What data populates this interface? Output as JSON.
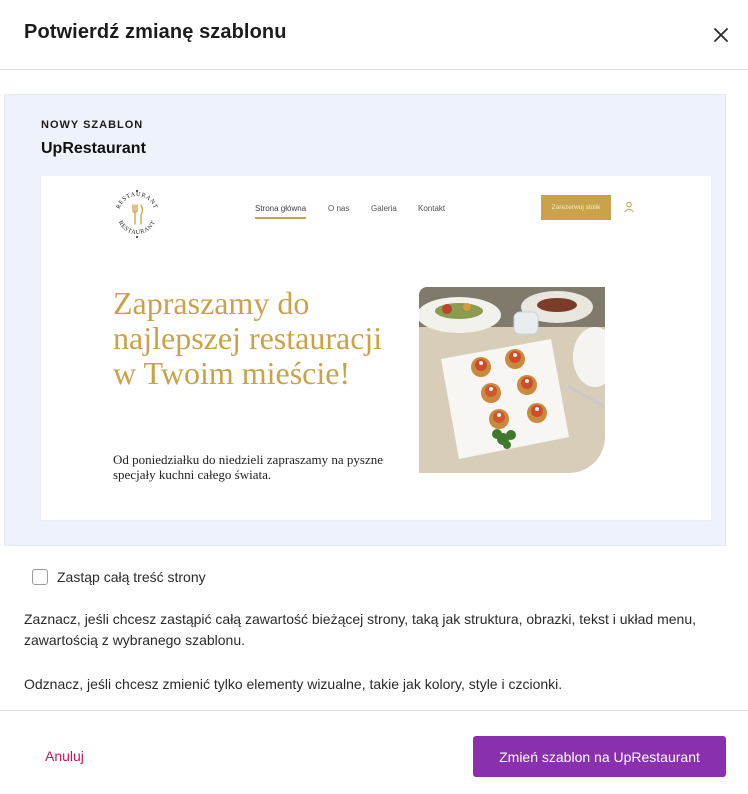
{
  "dialog": {
    "title": "Potwierdź zmianę szablonu"
  },
  "preview": {
    "eyebrow": "NOWY SZABLON",
    "template_name": "UpRestaurant",
    "site": {
      "logo_text_top": "RESTAURANT",
      "logo_text_bottom": "RESTAURANT",
      "nav": [
        "Strona główna",
        "O nas",
        "Galeria",
        "Kontakt"
      ],
      "cta": "Zarezerwuj stolik",
      "hero_title": "Zapraszamy do najlepszej restauracji w Twoim mieście!",
      "hero_subtitle": "Od poniedziałku do niedzieli zapraszamy na pyszne specjały kuchni całego świata."
    }
  },
  "option": {
    "label": "Zastąp całą treść strony",
    "checked": false
  },
  "help": {
    "checked_text": "Zaznacz, jeśli chcesz zastąpić całą zawartość bieżącej strony, taką jak struktura, obrazki, tekst i układ menu, zawartością z wybranego szablonu.",
    "unchecked_text": "Odznacz, jeśli chcesz zmienić tylko elementy wizualne, takie jak kolory, style i czcionki."
  },
  "footer": {
    "cancel_label": "Anuluj",
    "confirm_label": "Zmień szablon na UpRestaurant"
  },
  "colors": {
    "accent_purple": "#8a2fae",
    "cancel_pink": "#c2185b",
    "template_gold": "#c9a24a",
    "preview_bg": "#eef3fb"
  }
}
